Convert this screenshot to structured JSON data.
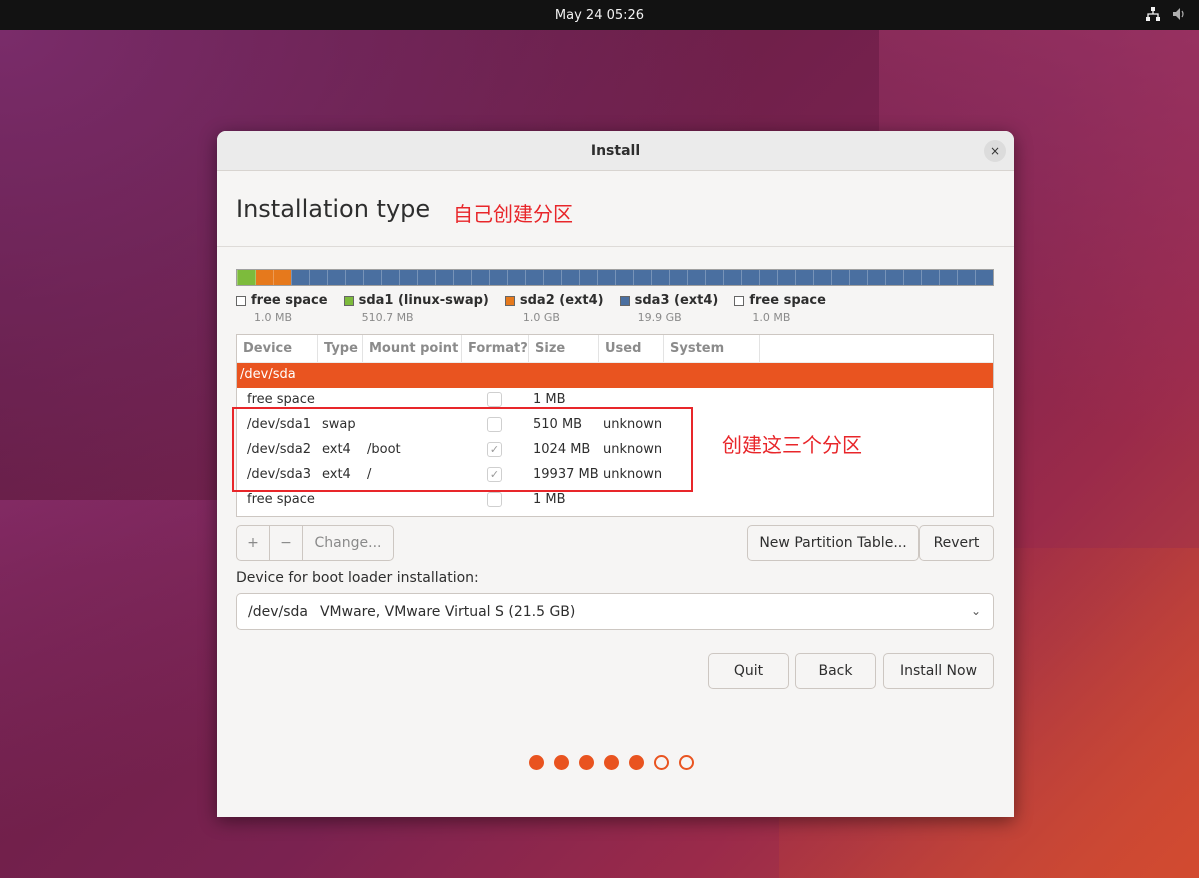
{
  "topbar": {
    "clock": "May 24  05:26"
  },
  "window": {
    "title": "Install",
    "close_glyph": "×"
  },
  "page": {
    "heading": "Installation type",
    "annotation_top": "自己创建分区",
    "annotation_side": "创建这三个分区"
  },
  "partition_bar": {
    "segments": [
      {
        "name": "free space",
        "color": "#ffffff",
        "fraction": 0.0005
      },
      {
        "name": "sda1 (linux-swap)",
        "color": "#7dbb3c",
        "fraction": 0.024
      },
      {
        "name": "sda2 (ext4)",
        "color": "#e6791c",
        "fraction": 0.047
      },
      {
        "name": "sda3 (ext4)",
        "color": "#4a6fa0",
        "fraction": 0.928
      },
      {
        "name": "free space",
        "color": "#ffffff",
        "fraction": 0.0005
      }
    ]
  },
  "legend": [
    {
      "label": "free space",
      "size": "1.0 MB",
      "color": "#ffffff"
    },
    {
      "label": "sda1 (linux-swap)",
      "size": "510.7 MB",
      "color": "#7dbb3c"
    },
    {
      "label": "sda2 (ext4)",
      "size": "1.0 GB",
      "color": "#e6791c"
    },
    {
      "label": "sda3 (ext4)",
      "size": "19.9 GB",
      "color": "#4a6fa0"
    },
    {
      "label": "free space",
      "size": "1.0 MB",
      "color": "#ffffff"
    }
  ],
  "table": {
    "headers": [
      "Device",
      "Type",
      "Mount point",
      "Format?",
      "Size",
      "Used",
      "System"
    ],
    "rows": [
      {
        "device": "/dev/sda",
        "type": "",
        "mount": "",
        "format": null,
        "size": "",
        "used": ""
      },
      {
        "device": "free space",
        "type": "",
        "mount": "",
        "format": false,
        "size": "1 MB",
        "used": ""
      },
      {
        "device": "/dev/sda1",
        "type": "swap",
        "mount": "",
        "format": false,
        "size": "510 MB",
        "used": "unknown"
      },
      {
        "device": "/dev/sda2",
        "type": "ext4",
        "mount": "/boot",
        "format": true,
        "size": "1024 MB",
        "used": "unknown"
      },
      {
        "device": "/dev/sda3",
        "type": "ext4",
        "mount": "/",
        "format": true,
        "size": "19937 MB",
        "used": "unknown"
      },
      {
        "device": "free space",
        "type": "",
        "mount": "",
        "format": false,
        "size": "1 MB",
        "used": ""
      }
    ]
  },
  "toolbar": {
    "add": "+",
    "remove": "−",
    "change": "Change...",
    "new_table": "New Partition Table...",
    "revert": "Revert"
  },
  "boot": {
    "label": "Device for boot loader installation:",
    "device": "/dev/sda",
    "description": "VMware, VMware Virtual S (21.5 GB)"
  },
  "actions": {
    "quit": "Quit",
    "back": "Back",
    "install": "Install Now"
  },
  "progress": {
    "total": 7,
    "completed": 5
  },
  "colors": {
    "accent": "#e95420",
    "annotation": "#e8262a"
  }
}
